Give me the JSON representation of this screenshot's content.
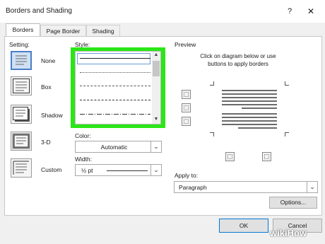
{
  "window": {
    "title": "Borders and Shading",
    "help": "?",
    "close": "✕"
  },
  "tabs": [
    {
      "label": "Borders",
      "active": true
    },
    {
      "label": "Page Border",
      "active": false
    },
    {
      "label": "Shading",
      "active": false
    }
  ],
  "setting": {
    "label": "Setting:",
    "options": [
      {
        "label": "None",
        "selected": true
      },
      {
        "label": "Box",
        "selected": false
      },
      {
        "label": "Shadow",
        "selected": false
      },
      {
        "label": "3-D",
        "selected": false
      },
      {
        "label": "Custom",
        "selected": false
      }
    ]
  },
  "style": {
    "label": "Style:",
    "items": [
      "solid",
      "dotted",
      "dashed-fine",
      "dashed",
      "dash-dot"
    ],
    "highlight_color": "#2ae616"
  },
  "color": {
    "label": "Color:",
    "value": "Automatic"
  },
  "width": {
    "label": "Width:",
    "value": "½ pt"
  },
  "preview": {
    "label": "Preview",
    "instructions": "Click on diagram below or use buttons to apply borders"
  },
  "apply_to": {
    "label": "Apply to:",
    "value": "Paragraph"
  },
  "buttons": {
    "options": "Options...",
    "ok": "OK",
    "cancel": "Cancel"
  },
  "watermark": "wikiHow",
  "colors": {
    "accent": "#4a7fc5",
    "highlight": "#2ae616",
    "background": "#f0f0f0"
  }
}
